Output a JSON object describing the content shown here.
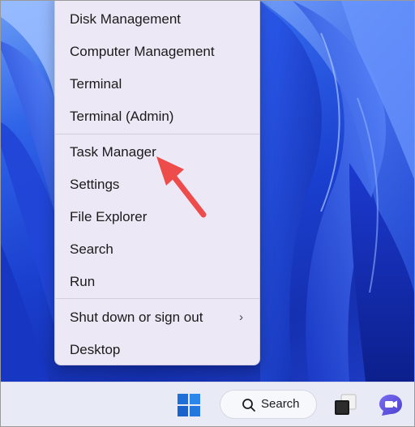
{
  "context_menu": {
    "items": [
      {
        "label": "Disk Management",
        "icon": ""
      },
      {
        "label": "Computer Management",
        "icon": ""
      },
      {
        "label": "Terminal",
        "icon": ""
      },
      {
        "label": "Terminal (Admin)",
        "icon": ""
      },
      {
        "label": "Task Manager",
        "icon": ""
      },
      {
        "label": "Settings",
        "icon": ""
      },
      {
        "label": "File Explorer",
        "icon": ""
      },
      {
        "label": "Search",
        "icon": ""
      },
      {
        "label": "Run",
        "icon": ""
      },
      {
        "label": "Shut down or sign out",
        "icon": "chevron-right-icon",
        "submenu_glyph": "›"
      },
      {
        "label": "Desktop",
        "icon": ""
      }
    ]
  },
  "annotation": {
    "icon": "red-arrow-icon",
    "color": "#ee4b4b"
  },
  "taskbar": {
    "start_icon": "windows-logo-icon",
    "search_label": "Search",
    "search_icon": "search-icon",
    "taskview_icon": "task-view-icon",
    "chat_icon": "chat-icon"
  },
  "colors": {
    "menu_background": "#ece8f6",
    "wallpaper_blue": "#1a3fcf",
    "taskbar_background": "#e8ebf5",
    "start_blue": "#1f6fd8"
  }
}
